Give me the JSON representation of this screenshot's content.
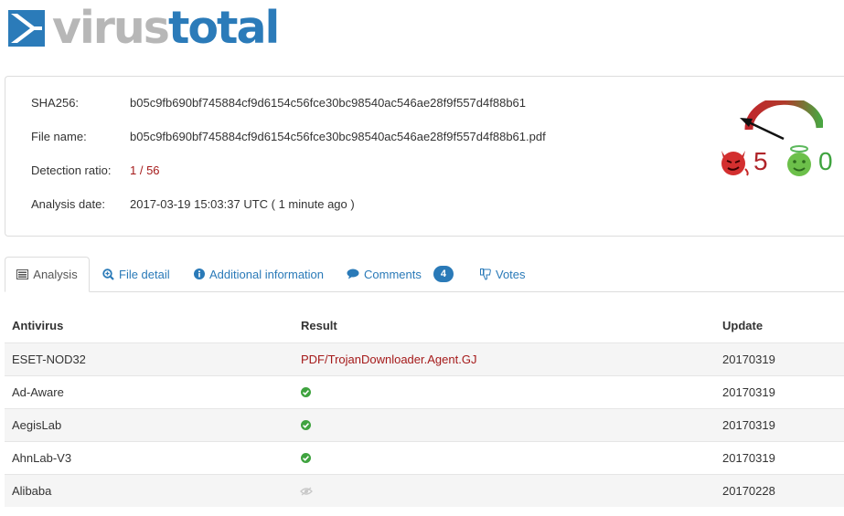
{
  "logo": {
    "part1": "virus",
    "part2": "total"
  },
  "info": {
    "sha256_label": "SHA256:",
    "sha256_value": "b05c9fb690bf745884cf9d6154c56fce30bc98540ac546ae28f9f557d4f88b61",
    "filename_label": "File name:",
    "filename_value": "b05c9fb690bf745884cf9d6154c56fce30bc98540ac546ae28f9f557d4f88b61.pdf",
    "ratio_label": "Detection ratio:",
    "ratio_value": "1 / 56",
    "date_label": "Analysis date:",
    "date_value": "2017-03-19 15:03:37 UTC ( 1 minute ago )"
  },
  "verdict": {
    "malicious": "5",
    "harmless": "0"
  },
  "colors": {
    "accent": "#2a7ab8",
    "danger": "#a51a1a",
    "safe": "#3fa33f",
    "undetected": "#cccccc"
  },
  "tabs": [
    {
      "label": "Analysis",
      "icon": "list-icon",
      "active": true
    },
    {
      "label": "File detail",
      "icon": "search-plus-icon"
    },
    {
      "label": "Additional information",
      "icon": "info-circle-icon"
    },
    {
      "label": "Comments",
      "icon": "comment-icon",
      "badge": "4"
    },
    {
      "label": "Votes",
      "icon": "thumbs-down-icon"
    }
  ],
  "table": {
    "headers": [
      "Antivirus",
      "Result",
      "Update"
    ],
    "rows": [
      {
        "antivirus": "ESET-NOD32",
        "result": "PDF/TrojanDownloader.Agent.GJ",
        "status": "detected",
        "update": "20170319"
      },
      {
        "antivirus": "Ad-Aware",
        "result": "",
        "status": "clean-check-icon",
        "update": "20170319"
      },
      {
        "antivirus": "AegisLab",
        "result": "",
        "status": "clean-check-icon",
        "update": "20170319"
      },
      {
        "antivirus": "AhnLab-V3",
        "result": "",
        "status": "clean-check-icon",
        "update": "20170319"
      },
      {
        "antivirus": "Alibaba",
        "result": "",
        "status": "unsupported-eye-icon",
        "update": "20170228"
      }
    ]
  }
}
